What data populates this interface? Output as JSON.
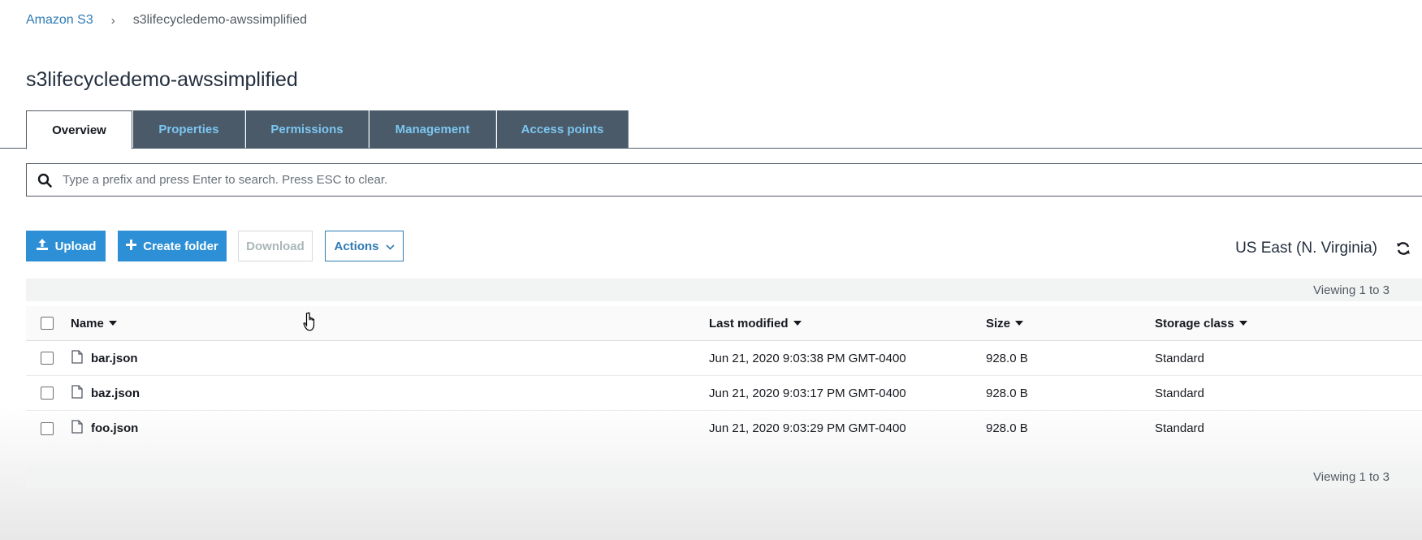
{
  "breadcrumb": {
    "root": "Amazon S3",
    "separator": "›",
    "current": "s3lifecycledemo-awssimplified"
  },
  "page_title": "s3lifecycledemo-awssimplified",
  "tabs": [
    {
      "label": "Overview",
      "active": true
    },
    {
      "label": "Properties",
      "active": false
    },
    {
      "label": "Permissions",
      "active": false
    },
    {
      "label": "Management",
      "active": false
    },
    {
      "label": "Access points",
      "active": false
    }
  ],
  "search": {
    "icon": "search-icon",
    "placeholder": "Type a prefix and press Enter to search. Press ESC to clear."
  },
  "toolbar": {
    "upload_label": "Upload",
    "create_folder_label": "Create folder",
    "download_label": "Download",
    "actions_label": "Actions",
    "region": "US East (N. Virginia)"
  },
  "viewing_top": "Viewing 1 to 3",
  "viewing_bottom": "Viewing 1 to 3",
  "table": {
    "columns": {
      "name": "Name",
      "last_modified": "Last modified",
      "size": "Size",
      "storage_class": "Storage class"
    },
    "rows": [
      {
        "name": "bar.json",
        "last_modified": "Jun 21, 2020 9:03:38 PM GMT-0400",
        "size": "928.0 B",
        "storage_class": "Standard"
      },
      {
        "name": "baz.json",
        "last_modified": "Jun 21, 2020 9:03:17 PM GMT-0400",
        "size": "928.0 B",
        "storage_class": "Standard"
      },
      {
        "name": "foo.json",
        "last_modified": "Jun 21, 2020 9:03:29 PM GMT-0400",
        "size": "928.0 B",
        "storage_class": "Standard"
      }
    ]
  },
  "colors": {
    "primary": "#2d8fd5",
    "link": "#2e7bb3",
    "tab_bg": "#4a5a69",
    "tab_text": "#7cc6f0"
  }
}
